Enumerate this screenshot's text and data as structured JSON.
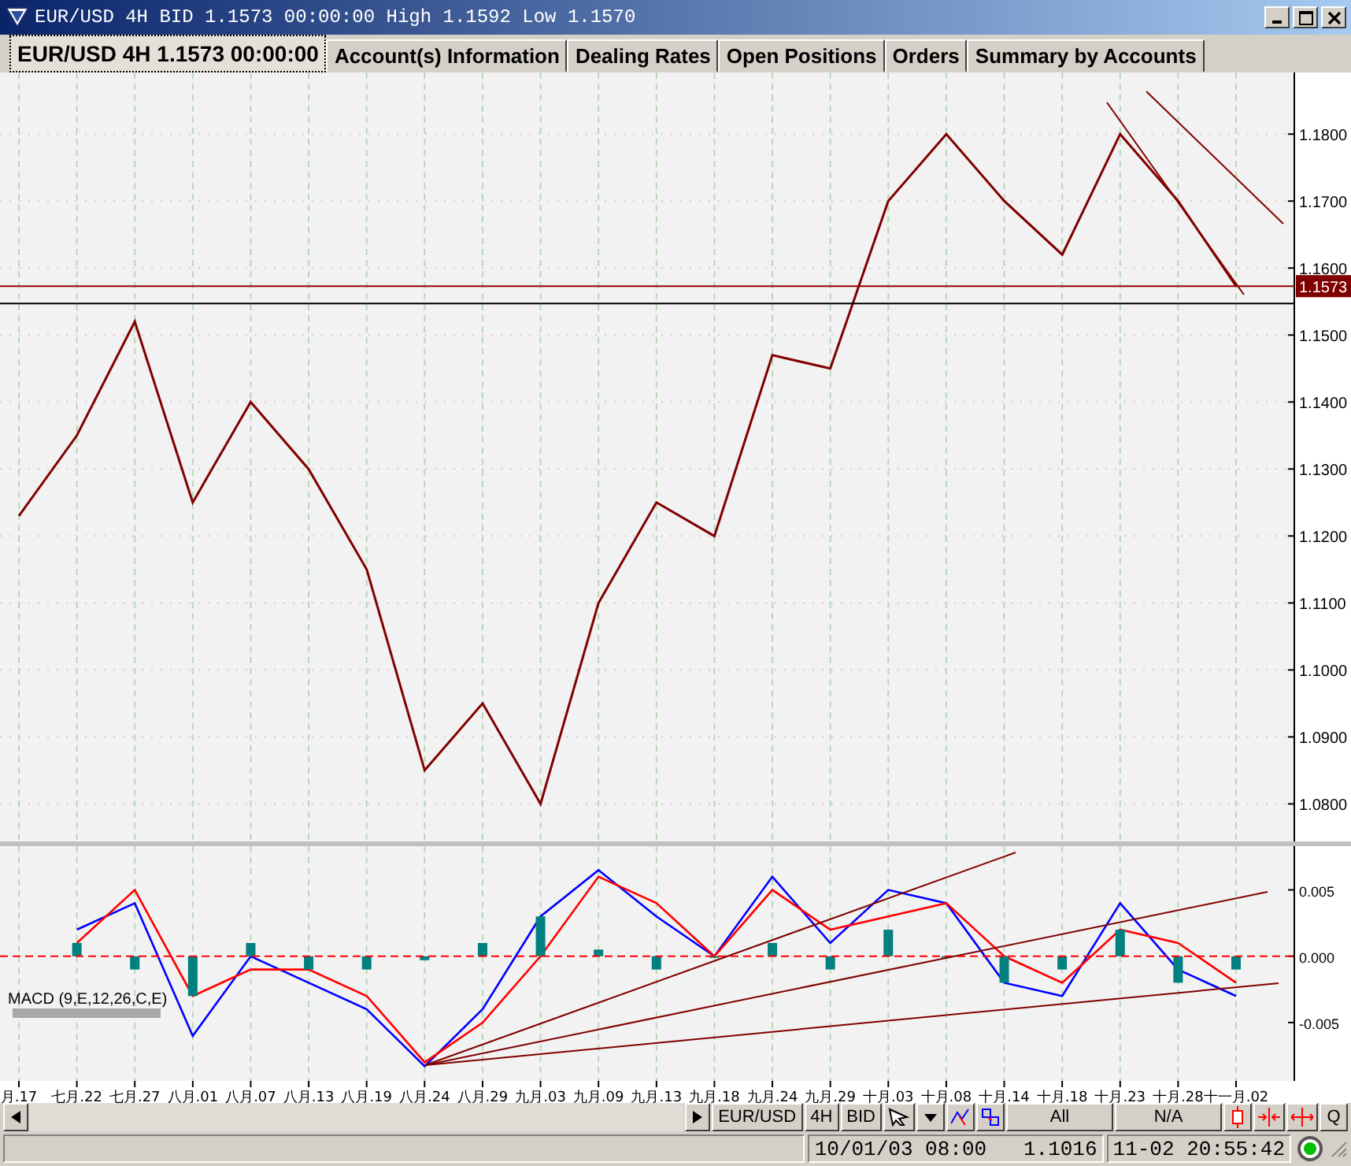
{
  "window": {
    "title": "EUR/USD 4H BID 1.1573 00:00:00 High 1.1592 Low 1.1570"
  },
  "tabs": [
    {
      "label": "EUR/USD 4H 1.1573 00:00:00",
      "selected": true
    },
    {
      "label": "Account(s) Information",
      "selected": false
    },
    {
      "label": "Dealing Rates",
      "selected": false
    },
    {
      "label": "Open Positions",
      "selected": false
    },
    {
      "label": "Orders",
      "selected": false
    },
    {
      "label": "Summary by Accounts",
      "selected": false
    }
  ],
  "price_chart": {
    "price_label": "1.1573",
    "chart_data": {
      "type": "line",
      "ylim": [
        1.0744,
        1.1892
      ],
      "yticks": [
        {
          "value": 1.08,
          "label": "1.0800"
        },
        {
          "value": 1.09,
          "label": "1.0900"
        },
        {
          "value": 1.1,
          "label": "1.1000"
        },
        {
          "value": 1.11,
          "label": "1.1100"
        },
        {
          "value": 1.12,
          "label": "1.1200"
        },
        {
          "value": 1.13,
          "label": "1.1300"
        },
        {
          "value": 1.14,
          "label": "1.1400"
        },
        {
          "value": 1.15,
          "label": "1.1500"
        },
        {
          "value": 1.16,
          "label": "1.1600"
        },
        {
          "value": 1.17,
          "label": "1.1700"
        },
        {
          "value": 1.18,
          "label": "1.1800"
        }
      ],
      "grid": true,
      "series": [
        {
          "color": "#800000",
          "values": [
            1.123,
            1.135,
            1.152,
            1.125,
            1.14,
            1.13,
            1.115,
            1.085,
            1.095,
            1.08,
            1.11,
            1.125,
            1.12,
            1.147,
            1.145,
            1.17,
            1.18,
            1.17,
            1.162,
            1.18,
            1.17,
            1.1573
          ]
        }
      ]
    }
  },
  "macd": {
    "label": "MACD (9,E,12,26,C,E)",
    "chart_data": {
      "type": "line",
      "ylim": [
        -0.0094,
        0.0083
      ],
      "categories": [
        "月.17",
        "七月.22",
        "七月.27",
        "八月.01",
        "八月.07",
        "八月.13",
        "八月.19",
        "八月.24",
        "八月.29",
        "九月.03",
        "九月.09",
        "九月.13",
        "九月.18",
        "九月.24",
        "九月.29",
        "十月.03",
        "十月.08",
        "十月.14",
        "十月.18",
        "十月.23",
        "十月.28",
        "十一月.02"
      ],
      "yticks": [
        {
          "value": 0.005,
          "label": "0.005"
        },
        {
          "value": 0,
          "label": "0.000"
        },
        {
          "value": -0.005,
          "label": "-0.005"
        }
      ],
      "grid": true,
      "series": [
        {
          "color": "#0000ff",
          "values": [
            null,
            0.002,
            0.004,
            -0.006,
            0.0,
            -0.002,
            -0.004,
            -0.0083,
            -0.004,
            0.003,
            0.0065,
            0.003,
            0.0,
            0.006,
            0.001,
            0.005,
            0.004,
            -0.002,
            -0.003,
            0.004,
            -0.001,
            -0.003
          ]
        },
        {
          "color": "#ff0000",
          "values": [
            null,
            0.001,
            0.005,
            -0.003,
            -0.001,
            -0.001,
            -0.003,
            -0.008,
            -0.005,
            0.0,
            0.006,
            0.004,
            0.0,
            0.005,
            0.002,
            0.003,
            0.004,
            0.0,
            -0.002,
            0.002,
            0.001,
            -0.002
          ]
        }
      ]
    }
  },
  "toolbar": {
    "symbol": "EUR/USD",
    "period": "4H",
    "side": "BID",
    "filter": "All",
    "mode": "N/A",
    "quote": "Q"
  },
  "status_bar": {
    "time": "10/01/03 08:00",
    "price": "1.1016",
    "clock": "11-02 20:55:42"
  }
}
